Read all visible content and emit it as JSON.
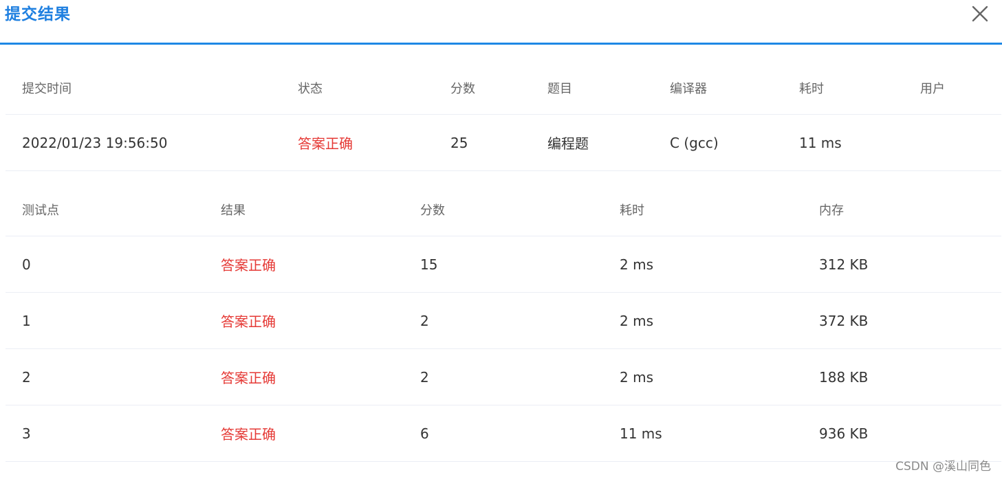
{
  "dialog": {
    "title": "提交结果",
    "accent_color": "#1e88e5",
    "close_icon": "close-icon"
  },
  "summary": {
    "headers": [
      "提交时间",
      "状态",
      "分数",
      "题目",
      "编译器",
      "耗时",
      "用户"
    ],
    "row": {
      "time": "2022/01/23 19:56:50",
      "status": "答案正确",
      "score": "25",
      "problem": "编程题",
      "compiler": "C (gcc)",
      "elapsed": "11 ms",
      "user": ""
    }
  },
  "cases": {
    "headers": [
      "测试点",
      "结果",
      "分数",
      "耗时",
      "内存"
    ],
    "rows": [
      {
        "id": "0",
        "result": "答案正确",
        "score": "15",
        "elapsed": "2 ms",
        "memory": "312 KB"
      },
      {
        "id": "1",
        "result": "答案正确",
        "score": "2",
        "elapsed": "2 ms",
        "memory": "372 KB"
      },
      {
        "id": "2",
        "result": "答案正确",
        "score": "2",
        "elapsed": "2 ms",
        "memory": "188 KB"
      },
      {
        "id": "3",
        "result": "答案正确",
        "score": "6",
        "elapsed": "11 ms",
        "memory": "936 KB"
      }
    ]
  },
  "status_color": "#e53935",
  "watermark": "CSDN @溪山同色"
}
